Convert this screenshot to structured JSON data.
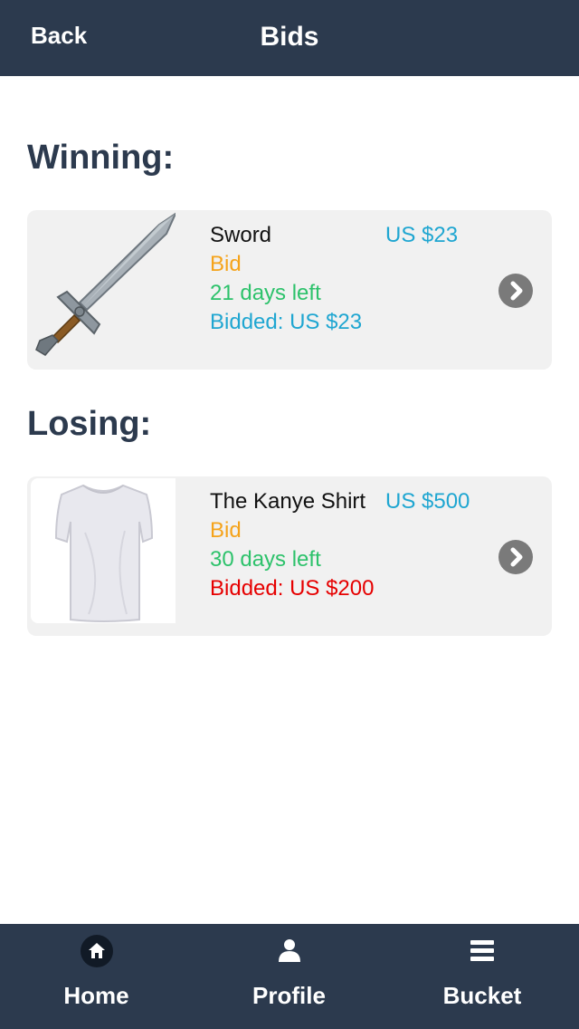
{
  "navbar": {
    "back_label": "Back",
    "title": "Bids"
  },
  "sections": {
    "winning_title": "Winning:",
    "losing_title": "Losing:"
  },
  "winning_item": {
    "name": "Sword",
    "price": "US $23",
    "status": "Bid",
    "time_left": "21 days left",
    "bidded": "Bidded: US $23",
    "image": "sword-image"
  },
  "losing_item": {
    "name": "The Kanye Shirt",
    "price": "US $500",
    "status": "Bid",
    "time_left": "30 days left",
    "bidded": "Bidded: US $200",
    "image": "white-tshirt-image"
  },
  "tabbar": {
    "home_label": "Home",
    "profile_label": "Profile",
    "bucket_label": "Bucket",
    "home_icon": "home-icon",
    "profile_icon": "user-icon",
    "bucket_icon": "list-icon"
  },
  "colors": {
    "nav_bg": "#2c3a4e",
    "card_bg": "#f1f1f1",
    "price": "#1fa6d1",
    "bid": "#f5a31a",
    "days_left": "#2dc26b",
    "bidded_winning": "#1fa6d1",
    "bidded_losing": "#e60000",
    "chevron": "#7a7a7a"
  }
}
